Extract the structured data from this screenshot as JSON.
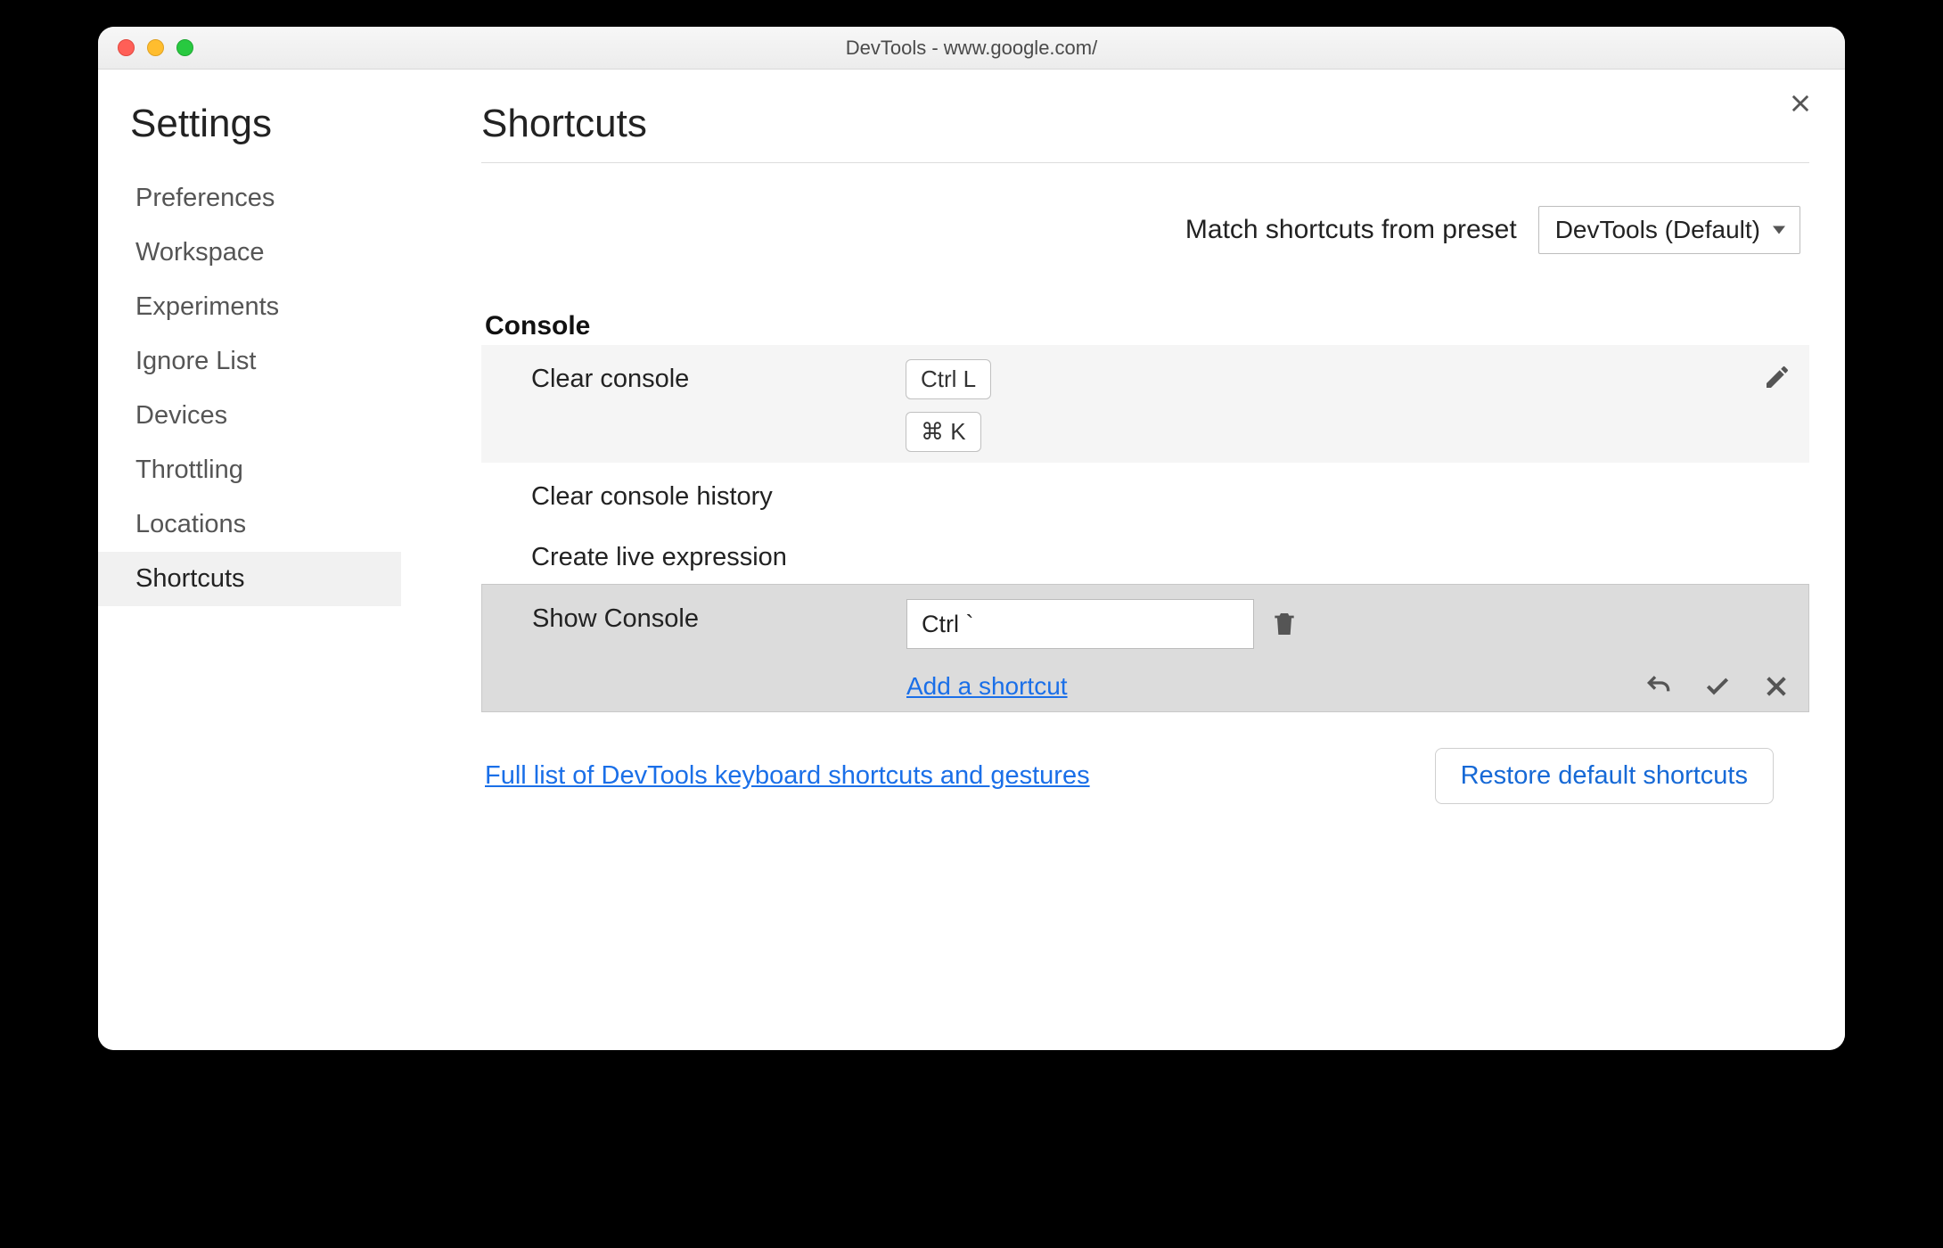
{
  "window_title": "DevTools - www.google.com/",
  "sidebar": {
    "title": "Settings",
    "items": [
      {
        "label": "Preferences"
      },
      {
        "label": "Workspace"
      },
      {
        "label": "Experiments"
      },
      {
        "label": "Ignore List"
      },
      {
        "label": "Devices"
      },
      {
        "label": "Throttling"
      },
      {
        "label": "Locations"
      },
      {
        "label": "Shortcuts"
      }
    ]
  },
  "main": {
    "title": "Shortcuts",
    "preset_label": "Match shortcuts from preset",
    "preset_value": "DevTools (Default)",
    "section": "Console",
    "rows": {
      "clear_console": {
        "name": "Clear console",
        "key1": "Ctrl L",
        "key2": "⌘ K"
      },
      "clear_history": {
        "name": "Clear console history"
      },
      "create_live": {
        "name": "Create live expression"
      },
      "show_console": {
        "name": "Show Console",
        "input_value": "Ctrl `",
        "add_label": "Add a shortcut"
      }
    },
    "footer_link": "Full list of DevTools keyboard shortcuts and gestures",
    "restore_label": "Restore default shortcuts"
  }
}
